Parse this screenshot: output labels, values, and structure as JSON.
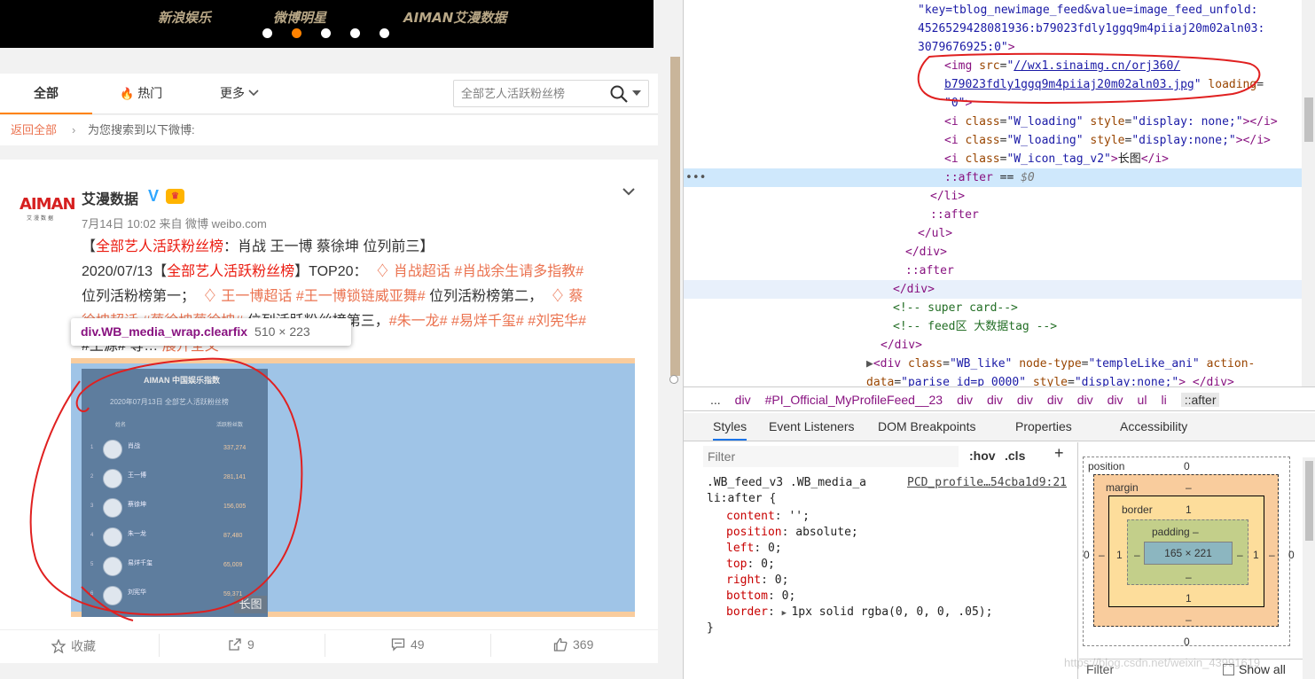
{
  "banner": {
    "brands": [
      "新浪娱乐",
      "微博明星",
      "AIMAN艾漫数据"
    ],
    "active_dot": 1
  },
  "tabs": {
    "all": "全部",
    "hot": "热门",
    "more": "更多"
  },
  "search": {
    "value": "全部艺人活跃粉丝榜"
  },
  "crumbs": {
    "back": "返回全部",
    "message": "为您搜索到以下微博:"
  },
  "post": {
    "username": "艾漫数据",
    "avatar_text": "AIMAN",
    "avatar_sub": "艾漫数据",
    "vip": "V",
    "meta": "7月14日 10:02 来自 微博 weibo.com",
    "line1_pre": "【",
    "line1_hl": "全部艺人活跃粉丝榜",
    "line1_post": "：肖战 王一博 蔡徐坤 位列前三】",
    "line2_pre": "2020/07/13【",
    "line2_hl": "全部艺人活跃粉丝榜",
    "line2_mid": "】TOP20：",
    "topic1": "肖战超话",
    "tag1": "#肖战余生请多指教#",
    "line3_a": "位列活粉榜第一；",
    "topic2": "王一博超话",
    "tag2": "#王一博锁链威亚舞#",
    "line3_b": "位列活粉榜第二，",
    "topic3": "蔡",
    "line4_hidden": "徐坤超话 #蔡徐坤蔡徐坤#",
    "line4_mid": "位列活跃粉丝榜第三，",
    "tag3": "#朱一龙#",
    "tag4": "#易烊千玺#",
    "tag5": "#刘宪华#",
    "line5_hidden": "#王源# 等…",
    "expand": "展开全文"
  },
  "tooltip": {
    "selector": "div.WB_media_wrap.clearfix",
    "size": "510 × 223"
  },
  "image": {
    "title": "AIMAN 中国娱乐指数",
    "subtitle": "2020年07月13日 全部艺人活跃粉丝榜",
    "col_name": "姓名",
    "col_value": "活跃粉丝数",
    "rows": [
      {
        "rank": "1",
        "name": "肖战",
        "value": "337,274"
      },
      {
        "rank": "2",
        "name": "王一博",
        "value": "281,141"
      },
      {
        "rank": "3",
        "name": "蔡徐坤",
        "value": "156,005"
      },
      {
        "rank": "4",
        "name": "朱一龙",
        "value": "87,480"
      },
      {
        "rank": "5",
        "name": "易烊千玺",
        "value": "65,009"
      },
      {
        "rank": "6",
        "name": "刘宪华",
        "value": "59,371"
      }
    ],
    "long_tag": "长图"
  },
  "actions": {
    "fav": "收藏",
    "forward": "9",
    "comment": "49",
    "like": "369"
  },
  "devtools": {
    "lines": [
      {
        "indent": 244,
        "html": "<span class='av'>\"key=tblog_newimage_feed&amp;value=image_feed_unfold:</span>"
      },
      {
        "indent": 244,
        "html": "<span class='av'>4526529428081936:b79023fdly1ggq9m4piiaj20m02aln03:</span>"
      },
      {
        "indent": 244,
        "html": "<span class='av'>3079676925:0\"</span><span class='tg'>&gt;</span>"
      },
      {
        "indent": 274,
        "html": "<span class='tg'>&lt;img</span> <span class='at'>src</span>=<span class='av'>\"</span><span class='lk'>//wx1.sinaimg.cn/orj360/</span>"
      },
      {
        "indent": 274,
        "html": "<span class='lk'>b79023fdly1ggq9m4piiaj20m02aln03.jpg</span><span class='av'>\"</span> <span class='at'>loading</span>="
      },
      {
        "indent": 274,
        "html": "<span class='av'>\"0\"</span><span class='tg'>&gt;</span>"
      },
      {
        "indent": 274,
        "html": "<span class='tg'>&lt;i</span> <span class='at'>class</span>=<span class='av'>\"W_loading\"</span> <span class='at'>style</span>=<span class='av'>\"display: none;\"</span><span class='tg'>&gt;&lt;/i&gt;</span>"
      },
      {
        "indent": 274,
        "html": "<span class='tg'>&lt;i</span> <span class='at'>class</span>=<span class='av'>\"W_loading\"</span> <span class='at'>style</span>=<span class='av'>\"display:none;\"</span><span class='tg'>&gt;&lt;/i&gt;</span>"
      },
      {
        "indent": 274,
        "html": "<span class='tg'>&lt;i</span> <span class='at'>class</span>=<span class='av'>\"W_icon_tag_v2\"</span><span class='tg'>&gt;</span><span class='tx'>长图</span><span class='tg'>&lt;/i&gt;</span>"
      },
      {
        "indent": 274,
        "html": "<span class='ps'>::after</span> <span class='tx'>== </span><span style='color:#777;font-style:italic'>$0</span>"
      },
      {
        "indent": 258,
        "html": "<span class='tg'>&lt;/li&gt;</span>"
      },
      {
        "indent": 258,
        "html": "<span class='ps'>::after</span>"
      },
      {
        "indent": 244,
        "html": "<span class='tg'>&lt;/ul&gt;</span>"
      },
      {
        "indent": 230,
        "html": "<span class='tg'>&lt;/div&gt;</span>"
      },
      {
        "indent": 230,
        "html": "<span class='ps'>::after</span>"
      },
      {
        "indent": 216,
        "html": "<span class='tg'>&lt;/div&gt;</span>"
      },
      {
        "indent": 216,
        "html": "<span class='cm'>&lt;!-- super card--&gt;</span>"
      },
      {
        "indent": 216,
        "html": "<span class='cm'>&lt;!-- feed区 大数据tag --&gt;</span>"
      },
      {
        "indent": 202,
        "html": "<span class='tg'>&lt;/div&gt;</span>"
      },
      {
        "indent": 186,
        "html": "<span style='color:#555'>▶</span><span class='tg'>&lt;div</span> <span class='at'>class</span>=<span class='av'>\"WB_like\"</span> <span class='at'>node-type</span>=<span class='av'>\"templeLike_ani\"</span> <span class='at'>action-</span>"
      },
      {
        "indent": 186,
        "html": "<span class='at'>data</span>=<span class='av'>\"parise_id=p_0000\"</span> <span class='at'>style</span>=<span class='av'>\"display:none;\"</span><span class='tg'>&gt; &lt;/div&gt;</span>"
      }
    ],
    "breadcrumbs": [
      "...",
      "div",
      "#PI_Official_MyProfileFeed__23",
      "div",
      "div",
      "div",
      "div",
      "div",
      "div",
      "ul",
      "li",
      "::after"
    ],
    "panel_tabs": [
      "Styles",
      "Event Listeners",
      "DOM Breakpoints",
      "Properties",
      "Accessibility"
    ],
    "filter_placeholder": "Filter",
    "hov": ":hov",
    "cls": ".cls",
    "plus": "+",
    "rule_selector_1": ".WB_feed_v3 .WB_media_a",
    "rule_selector_2": "li:after {",
    "rule_source": "PCD_profile…54cba1d9:21",
    "declarations": [
      {
        "name": "content",
        "value": "'';"
      },
      {
        "name": "position",
        "value": "absolute;"
      },
      {
        "name": "left",
        "value": "0;"
      },
      {
        "name": "top",
        "value": "0;"
      },
      {
        "name": "right",
        "value": "0;"
      },
      {
        "name": "bottom",
        "value": "0;"
      },
      {
        "name": "border",
        "value": "1px solid rgba(0, 0, 0, .05);"
      }
    ],
    "rule_close": "}",
    "box": {
      "position_label": "position",
      "position_val": "0",
      "margin_label": "margin",
      "margin_val": "–",
      "border_label": "border",
      "border_val": "1",
      "padding_label": "padding –",
      "content": "165 × 221",
      "side_zero": "0",
      "side_dash": "–",
      "side_one": "1"
    },
    "bottom_filter": "Filter",
    "show_all": "Show all"
  },
  "watermark": "https://blog.csdn.net/weixin_43991619"
}
